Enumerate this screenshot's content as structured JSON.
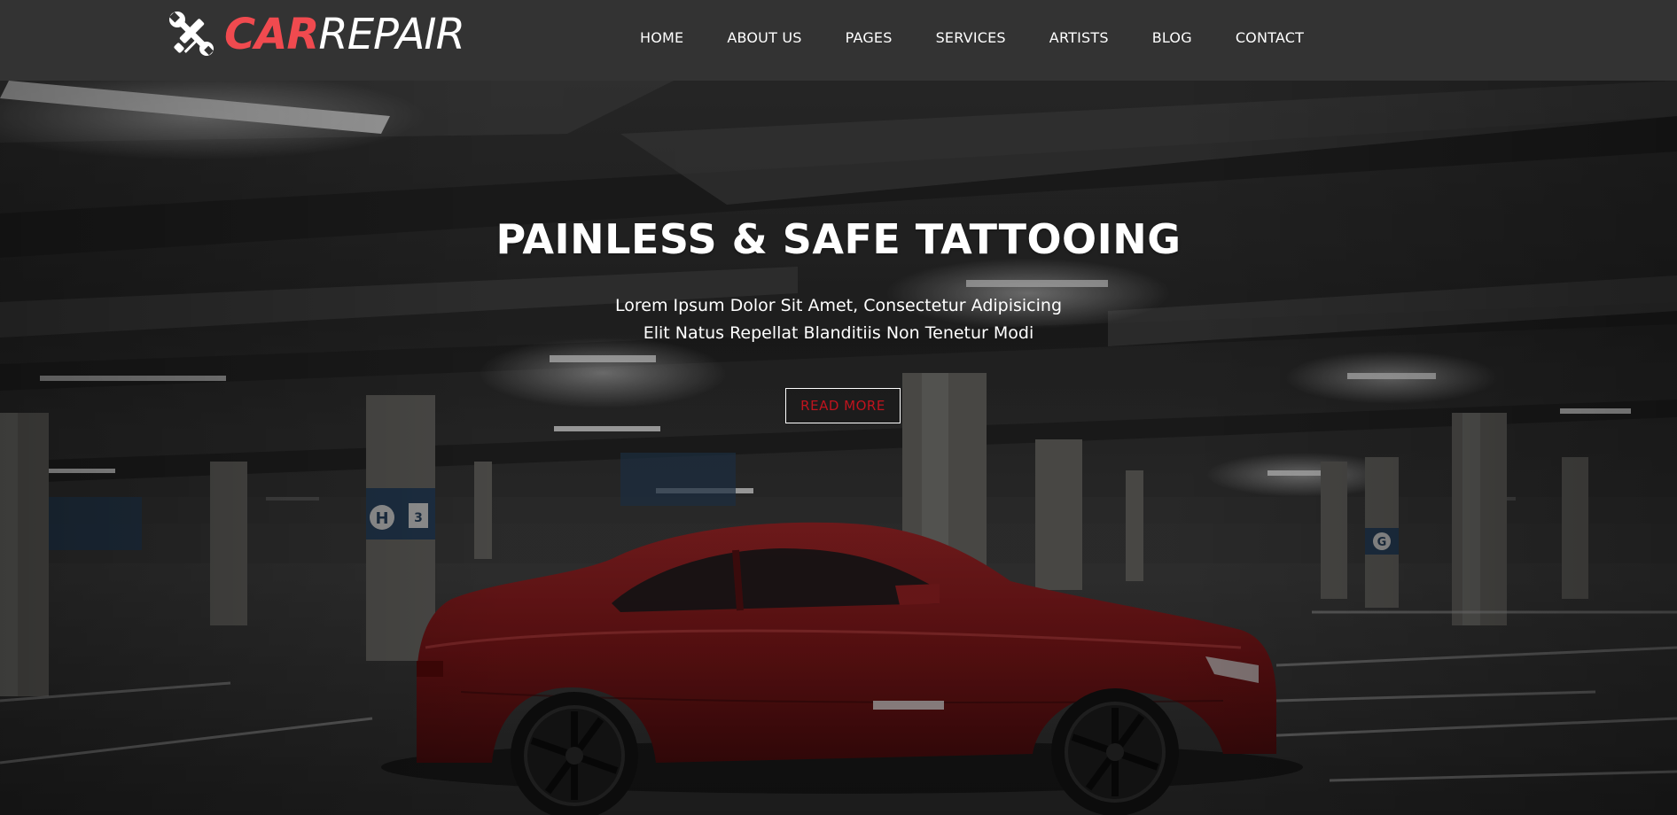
{
  "brand": {
    "car": "CAR",
    "repair": "REPAIR",
    "logo_icon": "wrench-screwdriver-icon",
    "accent_color": "#f04a4f"
  },
  "nav": {
    "items": [
      {
        "label": "HOME"
      },
      {
        "label": "ABOUT US"
      },
      {
        "label": "PAGES"
      },
      {
        "label": "SERVICES"
      },
      {
        "label": "ARTISTS"
      },
      {
        "label": "BLOG"
      },
      {
        "label": "CONTACT"
      }
    ]
  },
  "hero": {
    "title": "PAINLESS & SAFE TATTOOING",
    "subtitle_line1": "Lorem Ipsum Dolor Sit Amet, Consectetur Adipisicing",
    "subtitle_line2": "Elit Natus Repellat Blanditiis Non Tenetur Modi",
    "cta_label": "READ MORE",
    "cta_color": "#c0141e"
  },
  "scene": {
    "background": "underground-parking-garage",
    "car_color": "#8a1a1c",
    "sign_letters": [
      "H",
      "3",
      "G"
    ]
  }
}
